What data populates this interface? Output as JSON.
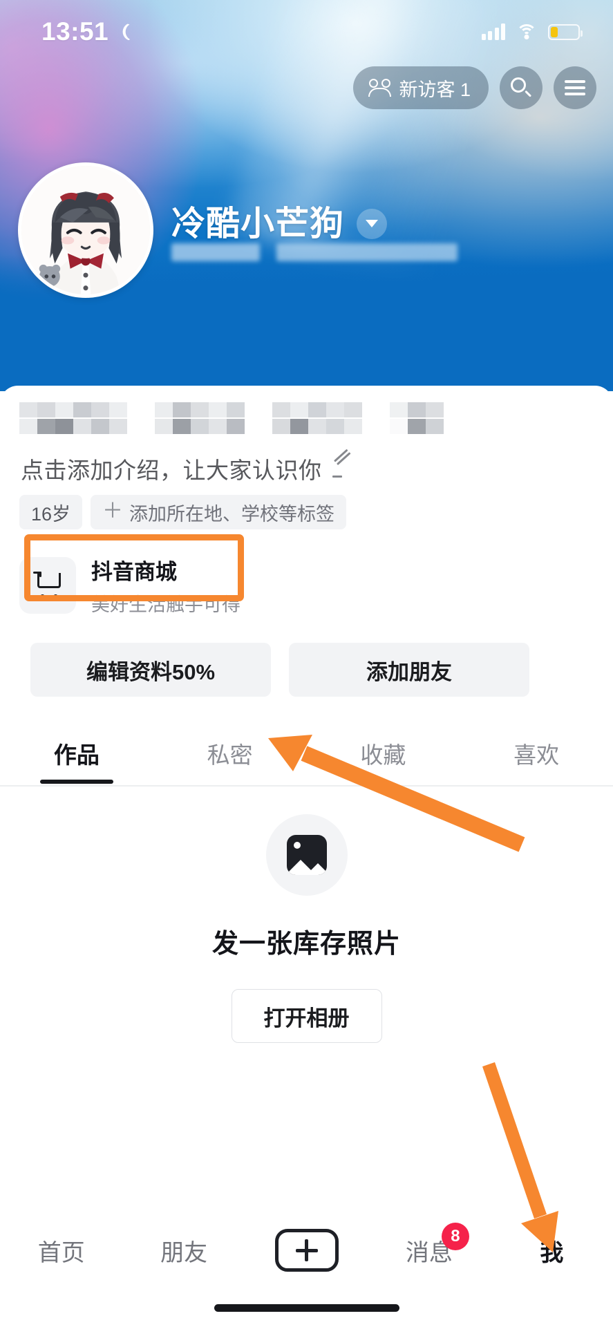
{
  "status_bar": {
    "time": "13:51",
    "moon_icon": "moon-icon",
    "signal_icon": "signal-bars-icon",
    "wifi_icon": "wifi-icon",
    "battery_icon": "battery-icon",
    "battery_level_pct": 27
  },
  "header": {
    "visitor_pill": {
      "icon": "people-icon",
      "label": "新访客 1"
    },
    "search_icon": "search-icon",
    "menu_icon": "hamburger-menu-icon",
    "username": "冷酷小芒狗",
    "dropdown_icon": "chevron-down-icon",
    "avatar": "user-avatar",
    "subtitle_redacted": true
  },
  "profile": {
    "stats_redacted": true,
    "bio_placeholder": "点击添加介绍，让大家认识你",
    "edit_bio_icon": "pencil-icon",
    "tags": [
      {
        "label": "16岁",
        "has_plus": false
      },
      {
        "label": "添加所在地、学校等标签",
        "has_plus": true
      }
    ],
    "shop": {
      "icon": "shopping-cart-icon",
      "title": "抖音商城",
      "subtitle": "美好生活触手可得"
    },
    "actions": [
      {
        "label": "编辑资料50%",
        "highlighted": true
      },
      {
        "label": "添加朋友",
        "highlighted": false
      }
    ]
  },
  "tabs": [
    {
      "label": "作品",
      "active": true
    },
    {
      "label": "私密",
      "active": false
    },
    {
      "label": "收藏",
      "active": false
    },
    {
      "label": "喜欢",
      "active": false
    }
  ],
  "empty_state": {
    "icon": "photo-placeholder-icon",
    "title": "发一张库存照片",
    "button_label": "打开相册"
  },
  "bottom_nav": {
    "items": [
      {
        "label": "首页",
        "active": false,
        "badge": null
      },
      {
        "label": "朋友",
        "active": false,
        "badge": null
      },
      {
        "label": "",
        "active": false,
        "badge": null,
        "icon": "plus-create-icon"
      },
      {
        "label": "消息",
        "active": false,
        "badge": "8"
      },
      {
        "label": "我",
        "active": true,
        "badge": null
      }
    ],
    "home_indicator": "home-indicator"
  },
  "annotations": {
    "color": "#f6872f",
    "highlight_box_target": "编辑资料50%",
    "arrows": [
      {
        "name": "arrow-to-edit-profile",
        "points_to": "编辑资料50%"
      },
      {
        "name": "arrow-to-me-tab",
        "points_to": "我"
      }
    ]
  },
  "colors": {
    "header_blue": "#0a6cc0",
    "accent_orange": "#f6872f",
    "badge_red": "#f5224a",
    "chip_gray": "#f2f3f5",
    "text_primary": "#14151a",
    "text_muted": "#8b8d94"
  }
}
